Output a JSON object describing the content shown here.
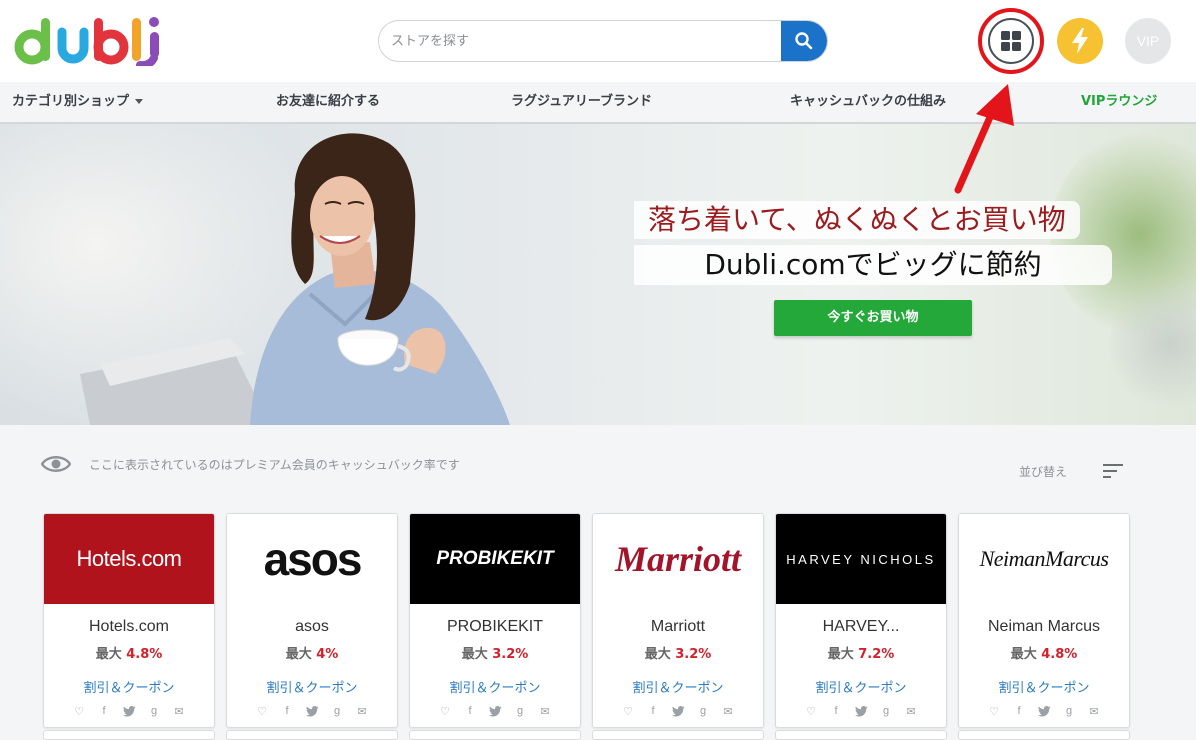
{
  "brand": {
    "logo_text": "dubli"
  },
  "search": {
    "placeholder": "ストアを探す",
    "icon": "search-icon"
  },
  "header_buttons": {
    "grid_icon": "grid-icon",
    "bolt_icon": "lightning-icon",
    "vip_label": "VIP"
  },
  "nav": {
    "items": [
      {
        "label": "カテゴリ別ショップ"
      },
      {
        "label": "お友達に紹介する"
      },
      {
        "label": "ラグジュアリーブランド"
      },
      {
        "label": "キャッシュバックの仕組み"
      },
      {
        "label": "VIPラウンジ"
      }
    ]
  },
  "hero": {
    "headline": "落ち着いて、ぬくぬくとお買い物",
    "subheadline": "Dubli.comでビッグに節約",
    "cta_label": "今すぐお買い物"
  },
  "info": {
    "notice": "ここに表示されているのはプレミアム会員のキャッシュバック率です",
    "sort_label": "並び替え"
  },
  "stores": [
    {
      "logo": "Hotels.com",
      "name": "Hotels.com",
      "rate_prefix": "最大",
      "rate": "4.8%",
      "coupon": "割引＆クーポン",
      "logo_bg": "#b1131c",
      "logo_fg": "#ffffff"
    },
    {
      "logo": "asos",
      "name": "asos",
      "rate_prefix": "最大",
      "rate": "4%",
      "coupon": "割引＆クーポン",
      "logo_bg": "#ffffff",
      "logo_fg": "#111111"
    },
    {
      "logo": "PROBIKEKIT",
      "name": "PROBIKEKIT",
      "rate_prefix": "最大",
      "rate": "3.2%",
      "coupon": "割引＆クーポン",
      "logo_bg": "#000000",
      "logo_fg": "#ffffff"
    },
    {
      "logo": "Marriott",
      "name": "Marriott",
      "rate_prefix": "最大",
      "rate": "3.2%",
      "coupon": "割引＆クーポン",
      "logo_bg": "#ffffff",
      "logo_fg": "#a3142a"
    },
    {
      "logo": "HARVEY NICHOLS",
      "name": "HARVEY...",
      "rate_prefix": "最大",
      "rate": "7.2%",
      "coupon": "割引＆クーポン",
      "logo_bg": "#000000",
      "logo_fg": "#ffffff"
    },
    {
      "logo": "NeimanMarcus",
      "name": "Neiman Marcus",
      "rate_prefix": "最大",
      "rate": "4.8%",
      "coupon": "割引＆クーポン",
      "logo_bg": "#ffffff",
      "logo_fg": "#111111"
    }
  ],
  "social_icons": [
    "heart-icon",
    "facebook-icon",
    "twitter-icon",
    "google-plus-icon",
    "email-icon"
  ],
  "colors": {
    "accent_blue": "#1a73c8",
    "cta_green": "#24a83a",
    "rate_red": "#d3202a",
    "highlight_red": "#e3151a"
  }
}
